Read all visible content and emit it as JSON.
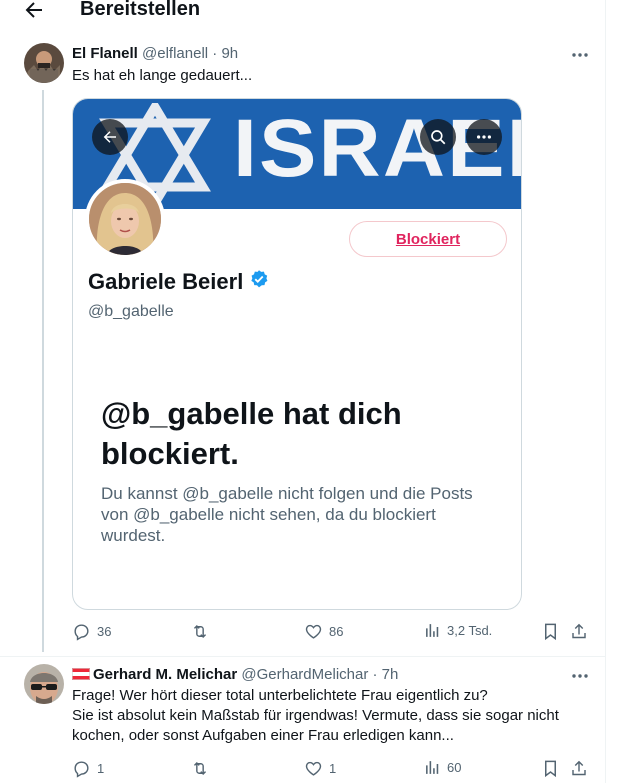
{
  "header": {
    "title": "Bereitstellen"
  },
  "tweet1": {
    "name": "El Flanell",
    "handle": "@elflanell",
    "time": "9h",
    "text": "Es hat eh lange gedauert...",
    "media": {
      "banner_text": "ISRAEL",
      "profile_name": "Gabriele Beierl",
      "profile_handle": "@b_gabelle",
      "blocked_button": "Blockiert",
      "blocked_title": "@b_gabelle hat dich blockiert.",
      "blocked_desc": "Du kannst @b_gabelle nicht folgen und die Posts von @b_gabelle nicht sehen, da du blockiert wurdest."
    },
    "stats": {
      "replies": "36",
      "retweets": "",
      "likes": "86",
      "views": "3,2 Tsd."
    }
  },
  "tweet2": {
    "name": "Gerhard M. Melichar",
    "handle": "@GerhardMelichar",
    "time": "7h",
    "text_lines": [
      "Frage! Wer hört dieser total unterbelichtete Frau eigentlich zu?",
      "Sie ist absolut kein Maßstab für irgendwas! Vermute, dass sie sogar nicht",
      "kochen, oder sonst Aufgaben einer Frau erledigen kann..."
    ],
    "stats": {
      "replies": "1",
      "retweets": "",
      "likes": "1",
      "views": "60"
    }
  },
  "colors": {
    "accent": "#1d9bf0",
    "blocked_red": "#e0245e",
    "muted": "#536471",
    "banner_blue": "#1d62b0",
    "flag_red": "#ed2939"
  },
  "icons": [
    "back-arrow-icon",
    "more-icon",
    "star-of-david-icon",
    "search-icon",
    "verified-badge-icon",
    "reply-icon",
    "retweet-icon",
    "like-icon",
    "views-icon",
    "bookmark-icon",
    "share-icon",
    "austria-flag-icon"
  ]
}
